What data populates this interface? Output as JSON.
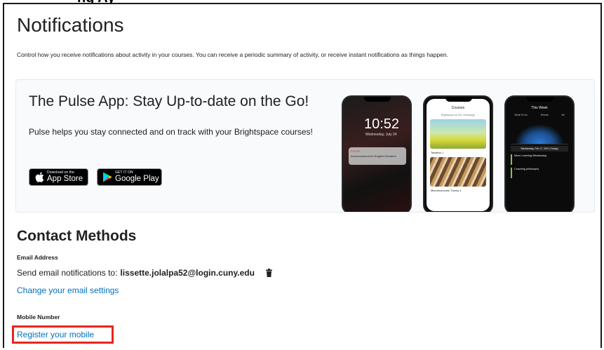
{
  "page": {
    "title": "Notifications",
    "description": "Control how you receive notifications about activity in your courses. You can receive a periodic summary of activity, or receive instant notifications as things happen."
  },
  "pulse": {
    "title": "The Pulse App: Stay Up-to-date on the Go!",
    "text": "Pulse helps you stay connected and on track with your Brightspace courses!",
    "app_store_small": "Download on the",
    "app_store_big": "App Store",
    "google_small": "GET IT ON",
    "google_big": "Google Play",
    "phone_lock_time": "10:52",
    "phone_lock_date": "Wednesday, July 24",
    "phone_courses_title": "Courses",
    "phone_course_1": "Taxation 1",
    "phone_course_2": "Microeconomic Theory 1",
    "phone_calendar_title": "This Week",
    "phone_cal_item_1": "Micro Learning Wednesday",
    "phone_cal_item_2": "Coaching philosophy"
  },
  "contact": {
    "title": "Contact Methods",
    "email_label": "Email Address",
    "email_prefix": "Send email notifications to:",
    "email_value": "lissette.jolalpa52@login.cuny.edu",
    "change_email_link": "Change your email settings",
    "mobile_label": "Mobile Number",
    "register_mobile_link": "Register your mobile"
  },
  "colors": {
    "link": "#006fbf",
    "highlight_box": "#e8261c"
  }
}
